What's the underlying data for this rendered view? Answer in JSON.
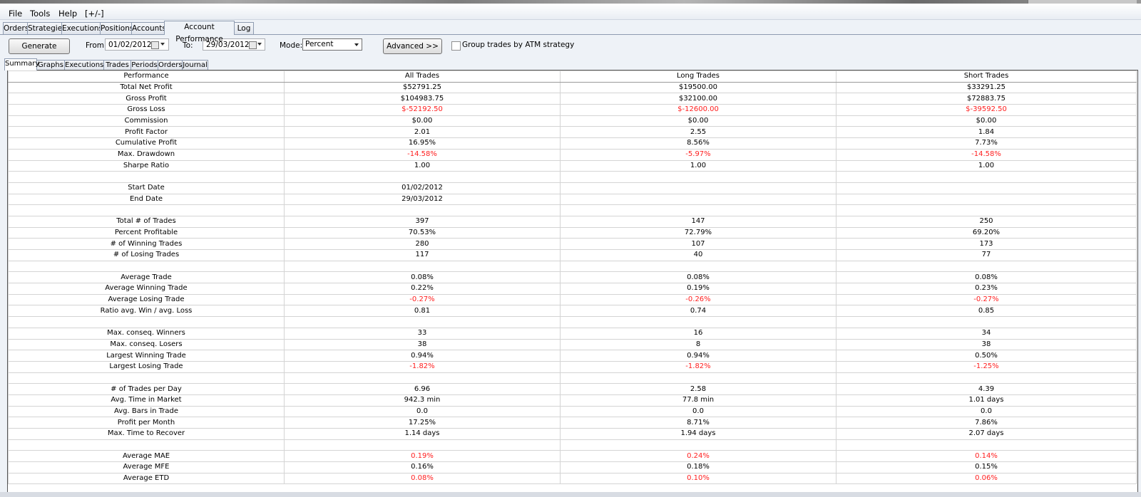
{
  "menu": {
    "file": "File",
    "tools": "Tools",
    "help": "Help",
    "toggle": "[+/-]"
  },
  "main_tabs": [
    "Orders",
    "Strategies",
    "Executions",
    "Positions",
    "Accounts",
    "Account Performance",
    "Log"
  ],
  "active_main_tab": "Account Performance",
  "toolbar": {
    "generate_label": "Generate",
    "from_label": "From:",
    "from_value": "01/02/2012",
    "to_label": "To:",
    "to_value": "29/03/2012",
    "mode_label": "Mode:",
    "mode_value": "Percent",
    "advanced_label": "Advanced >>",
    "group_label": "Group trades by ATM strategy",
    "group_checked": false
  },
  "sub_tabs": [
    "Summary",
    "Graphs",
    "Executions",
    "Trades",
    "Periods",
    "Orders",
    "Journal"
  ],
  "active_sub_tab": "Summary",
  "colors": {
    "negative": "#ff2020",
    "tab_border": "#8e9bb0"
  },
  "table": {
    "headers": [
      "Performance",
      "All Trades",
      "Long Trades",
      "Short Trades"
    ],
    "rows": [
      {
        "metric": "Total Net Profit",
        "all": "$52791.25",
        "long": "$19500.00",
        "short": "$33291.25"
      },
      {
        "metric": "Gross Profit",
        "all": "$104983.75",
        "long": "$32100.00",
        "short": "$72883.75"
      },
      {
        "metric": "Gross Loss",
        "all": "$-52192.50",
        "long": "$-12600.00",
        "short": "$-39592.50",
        "neg": true
      },
      {
        "metric": "Commission",
        "all": "$0.00",
        "long": "$0.00",
        "short": "$0.00"
      },
      {
        "metric": "Profit Factor",
        "all": "2.01",
        "long": "2.55",
        "short": "1.84"
      },
      {
        "metric": "Cumulative Profit",
        "all": "16.95%",
        "long": "8.56%",
        "short": "7.73%"
      },
      {
        "metric": "Max. Drawdown",
        "all": "-14.58%",
        "long": "-5.97%",
        "short": "-14.58%",
        "neg": true
      },
      {
        "metric": "Sharpe Ratio",
        "all": "1.00",
        "long": "1.00",
        "short": "1.00"
      },
      {
        "metric": "",
        "all": "",
        "long": "",
        "short": ""
      },
      {
        "metric": "Start Date",
        "all": "01/02/2012",
        "long": "",
        "short": ""
      },
      {
        "metric": "End Date",
        "all": "29/03/2012",
        "long": "",
        "short": ""
      },
      {
        "metric": "",
        "all": "",
        "long": "",
        "short": ""
      },
      {
        "metric": "Total # of Trades",
        "all": "397",
        "long": "147",
        "short": "250"
      },
      {
        "metric": "Percent Profitable",
        "all": "70.53%",
        "long": "72.79%",
        "short": "69.20%"
      },
      {
        "metric": "# of Winning Trades",
        "all": "280",
        "long": "107",
        "short": "173"
      },
      {
        "metric": "# of Losing Trades",
        "all": "117",
        "long": "40",
        "short": "77"
      },
      {
        "metric": "",
        "all": "",
        "long": "",
        "short": ""
      },
      {
        "metric": "Average Trade",
        "all": "0.08%",
        "long": "0.08%",
        "short": "0.08%"
      },
      {
        "metric": "Average Winning Trade",
        "all": "0.22%",
        "long": "0.19%",
        "short": "0.23%"
      },
      {
        "metric": "Average Losing Trade",
        "all": "-0.27%",
        "long": "-0.26%",
        "short": "-0.27%",
        "neg": true
      },
      {
        "metric": "Ratio avg. Win / avg. Loss",
        "all": "0.81",
        "long": "0.74",
        "short": "0.85"
      },
      {
        "metric": "",
        "all": "",
        "long": "",
        "short": ""
      },
      {
        "metric": "Max. conseq. Winners",
        "all": "33",
        "long": "16",
        "short": "34"
      },
      {
        "metric": "Max. conseq. Losers",
        "all": "38",
        "long": "8",
        "short": "38"
      },
      {
        "metric": "Largest Winning Trade",
        "all": "0.94%",
        "long": "0.94%",
        "short": "0.50%"
      },
      {
        "metric": "Largest Losing Trade",
        "all": "-1.82%",
        "long": "-1.82%",
        "short": "-1.25%",
        "neg": true
      },
      {
        "metric": "",
        "all": "",
        "long": "",
        "short": ""
      },
      {
        "metric": "# of Trades per Day",
        "all": "6.96",
        "long": "2.58",
        "short": "4.39"
      },
      {
        "metric": "Avg. Time in Market",
        "all": "942.3 min",
        "long": "77.8 min",
        "short": "1.01 days"
      },
      {
        "metric": "Avg. Bars in Trade",
        "all": "0.0",
        "long": "0.0",
        "short": "0.0"
      },
      {
        "metric": "Profit per Month",
        "all": "17.25%",
        "long": "8.71%",
        "short": "7.86%"
      },
      {
        "metric": "Max. Time to Recover",
        "all": "1.14 days",
        "long": "1.94 days",
        "short": "2.07 days"
      },
      {
        "metric": "",
        "all": "",
        "long": "",
        "short": ""
      },
      {
        "metric": "Average MAE",
        "all": "0.19%",
        "long": "0.24%",
        "short": "0.14%",
        "neg": true
      },
      {
        "metric": "Average MFE",
        "all": "0.16%",
        "long": "0.18%",
        "short": "0.15%"
      },
      {
        "metric": "Average ETD",
        "all": "0.08%",
        "long": "0.10%",
        "short": "0.06%",
        "neg": true
      }
    ]
  }
}
